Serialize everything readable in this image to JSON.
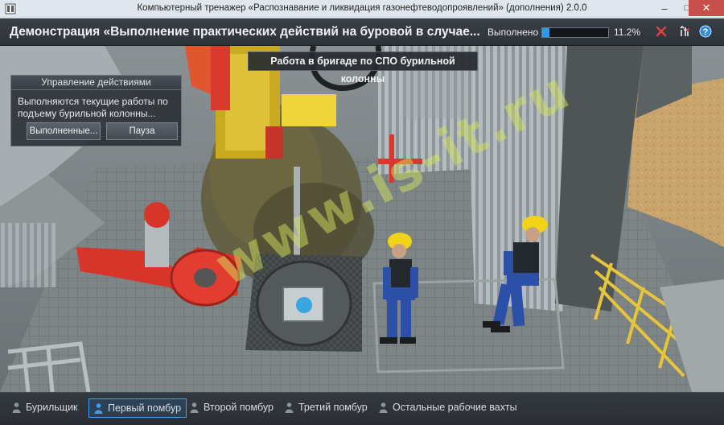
{
  "window": {
    "title": "Компьютерный тренажер «Распознавание и ликвидация газонефтеводопроявлений» (дополнения) 2.0.0",
    "icon": "app-icon",
    "minimize": "–",
    "maximize": "□",
    "close": "✕"
  },
  "header": {
    "title": "Демонстрация «Выполнение практических действий на буровой в случае...",
    "progress_label": "Выполнено",
    "progress_percent": "11.2%",
    "progress_value": 0.112,
    "accent_color": "#2e9be6"
  },
  "banner": {
    "text": "Работа в бригаде по СПО бурильной колонны"
  },
  "panel": {
    "title": "Управление действиями",
    "text": "Выполняются текущие работы по подъему бурильной колонны...",
    "btn_done": "Выполненные...",
    "btn_pause": "Пауза"
  },
  "watermark": {
    "text": "www.is-it.ru"
  },
  "tabs": [
    {
      "label": "Бурильщик",
      "active": false
    },
    {
      "label": "Первый помбур",
      "active": true
    },
    {
      "label": "Второй помбур",
      "active": false
    },
    {
      "label": "Третий помбур",
      "active": false
    },
    {
      "label": "Остальные рабочие вахты",
      "active": false
    }
  ]
}
